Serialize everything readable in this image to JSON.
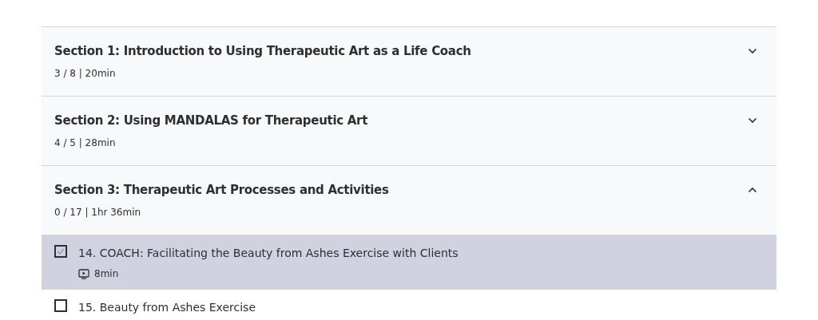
{
  "sections": [
    {
      "title": "Section 1: Introduction to Using Therapeutic Art as a Life Coach",
      "meta": "3 / 8 | 20min",
      "expanded": false
    },
    {
      "title": "Section 2: Using MANDALAS for Therapeutic Art",
      "meta": "4 / 5 | 28min",
      "expanded": false
    },
    {
      "title": "Section 3: Therapeutic Art Processes and Activities",
      "meta": "0 / 17 | 1hr 36min",
      "expanded": true,
      "lessons": [
        {
          "title": "14. COACH: Facilitating the Beauty from Ashes Exercise with Clients",
          "duration": "8min",
          "selected": true,
          "checked": false
        },
        {
          "title": "15. Beauty from Ashes Exercise",
          "selected": false,
          "checked": false
        }
      ]
    }
  ]
}
